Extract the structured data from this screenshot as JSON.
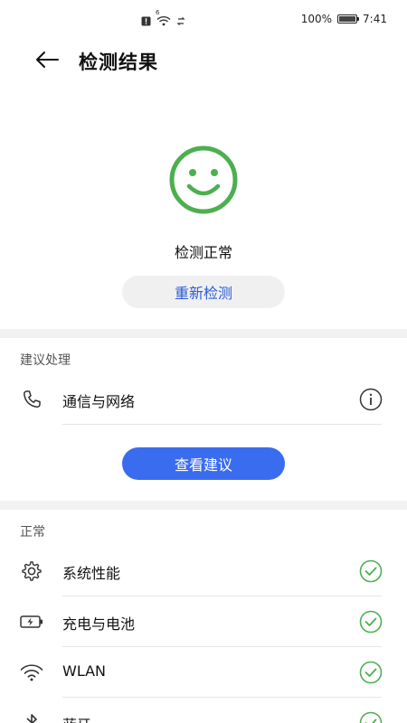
{
  "status_bar": {
    "battery_text": "100%",
    "battery_level": 1.0,
    "time": "7:41",
    "network_indicator": "6",
    "icons": [
      "alert-icon",
      "wifi-icon",
      "sync-icon",
      "battery-icon"
    ]
  },
  "header": {
    "title": "检测结果",
    "back_icon": "arrow-left-icon"
  },
  "result": {
    "icon": "smiley-icon",
    "text": "检测正常",
    "recheck_label": "重新检测",
    "color": "#4caf50"
  },
  "suggestions": {
    "header": "建议处理",
    "items": [
      {
        "label": "通信与网络",
        "icon": "phone-icon",
        "status_icon": "info-icon"
      }
    ],
    "button_label": "查看建议"
  },
  "normal": {
    "header": "正常",
    "items": [
      {
        "label": "系统性能",
        "icon": "gear-icon",
        "status_icon": "check-circle-icon"
      },
      {
        "label": "充电与电池",
        "icon": "battery-charging-icon",
        "status_icon": "check-circle-icon"
      },
      {
        "label": "WLAN",
        "icon": "wifi-icon",
        "status_icon": "check-circle-icon"
      },
      {
        "label": "蓝牙",
        "icon": "bluetooth-icon",
        "status_icon": "check-circle-icon"
      }
    ]
  },
  "colors": {
    "accent": "#3a6cf0",
    "link": "#2a5cd6",
    "ok_green": "#4caf50",
    "band": "#f2f2f2"
  }
}
